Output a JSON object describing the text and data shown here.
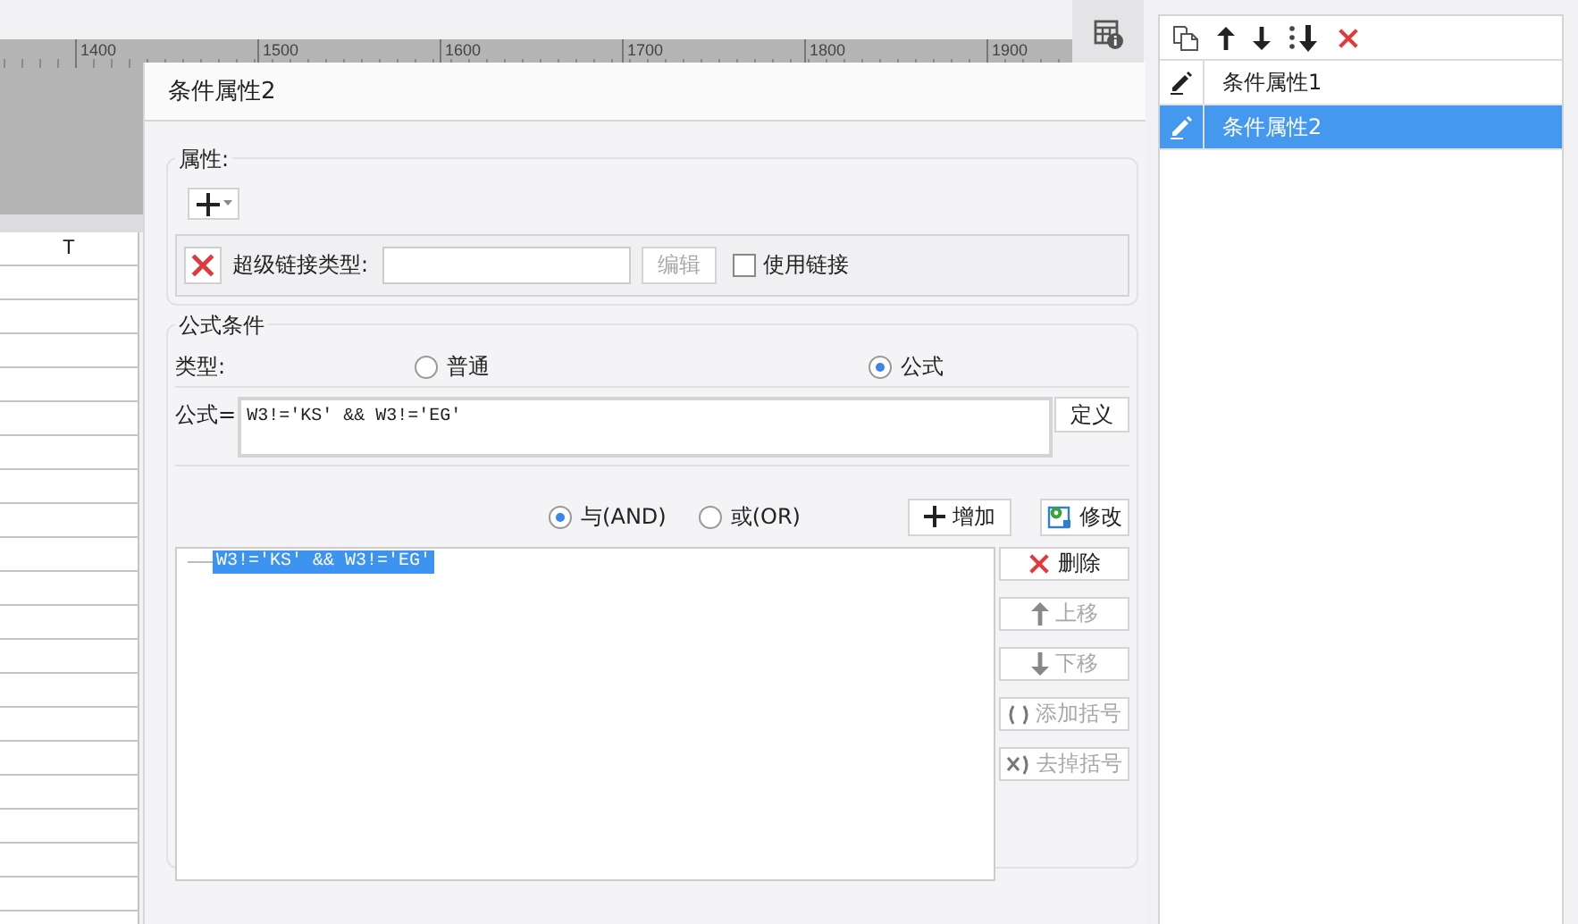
{
  "ruler": {
    "labels": [
      "1400",
      "1500",
      "1600",
      "1700",
      "1800",
      "1900"
    ]
  },
  "sheet": {
    "column_header": "T"
  },
  "dialog": {
    "title": "条件属性2",
    "attributes": {
      "legend": "属性:",
      "link_type_label": "超级链接类型:",
      "edit_button": {
        "label": "编辑",
        "disabled": true
      },
      "use_link": {
        "label": "使用链接",
        "checked": false
      }
    },
    "formula_condition": {
      "legend": "公式条件",
      "type_label": "类型:",
      "types": [
        {
          "label": "普通",
          "selected": false
        },
        {
          "label": "公式",
          "selected": true
        }
      ],
      "formula_label": "公式=",
      "formula": "W3!='KS' && W3!='EG'",
      "define_button": "定义",
      "logic": [
        {
          "label": "与(AND)",
          "selected": true
        },
        {
          "label": "或(OR)",
          "selected": false
        }
      ],
      "add_button": "增加",
      "modify_button": "修改",
      "conditions": [
        {
          "text": "W3!='KS' && W3!='EG'",
          "selected": true
        }
      ],
      "side_buttons": [
        {
          "kind": "delete",
          "label": "删除",
          "disabled": false
        },
        {
          "kind": "up",
          "label": "上移",
          "disabled": true
        },
        {
          "kind": "down",
          "label": "下移",
          "disabled": true
        },
        {
          "kind": "add-bracket",
          "label": "添加括号",
          "disabled": true
        },
        {
          "kind": "remove-bracket",
          "label": "去掉括号",
          "disabled": true
        }
      ]
    }
  },
  "condition_list": {
    "items": [
      {
        "label": "条件属性1",
        "selected": false
      },
      {
        "label": "条件属性2",
        "selected": true
      }
    ]
  }
}
